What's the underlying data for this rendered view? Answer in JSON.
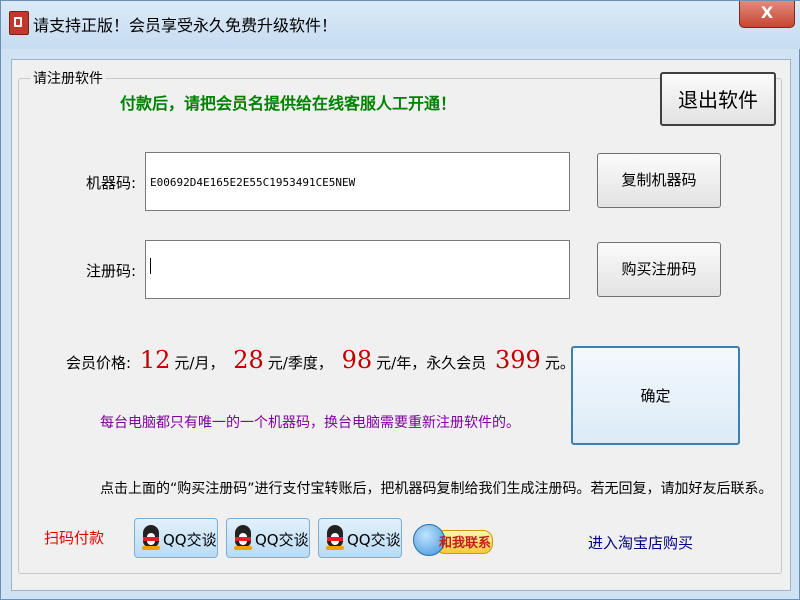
{
  "window": {
    "title": "请支持正版！会员享受永久免费升级软件！",
    "close_label": "X"
  },
  "group_label": "请注册软件",
  "notice": "付款后，请把会员名提供给在线客服人工开通！",
  "exit_button": "退出软件",
  "machine_code": {
    "label": "机器码:",
    "value": "E00692D4E165E2E55C1953491CE5NEW",
    "copy_button": "复制机器码"
  },
  "register_code": {
    "label": "注册码:",
    "value": "",
    "buy_button": "购买注册码"
  },
  "price": {
    "label": "会员价格:",
    "monthly": "12",
    "monthly_unit": "元/月，",
    "quarterly": "28",
    "quarterly_unit": "元/季度，",
    "yearly": "98",
    "yearly_unit": "元/年，永久会员",
    "lifetime": "399",
    "lifetime_unit": "元。"
  },
  "confirm_button": "确定",
  "note_unique": "每台电脑都只有唯一的一个机器码，换台电脑需要重新注册软件的。",
  "instruction": "点击上面的“购买注册码”进行支付宝转账后，把机器码复制给我们生成注册码。若无回复，请加好友后联系。",
  "scan_pay": "扫码付款",
  "qq_buttons": [
    "QQ交谈",
    "QQ交谈",
    "QQ交谈"
  ],
  "chat_contact": "和我联系",
  "taobao_link": "进入淘宝店购买",
  "colors": {
    "notice": "#008000",
    "price_numbers": "#c00000",
    "note": "#8000a0",
    "scan_pay": "#e00000",
    "taobao": "#000080"
  }
}
